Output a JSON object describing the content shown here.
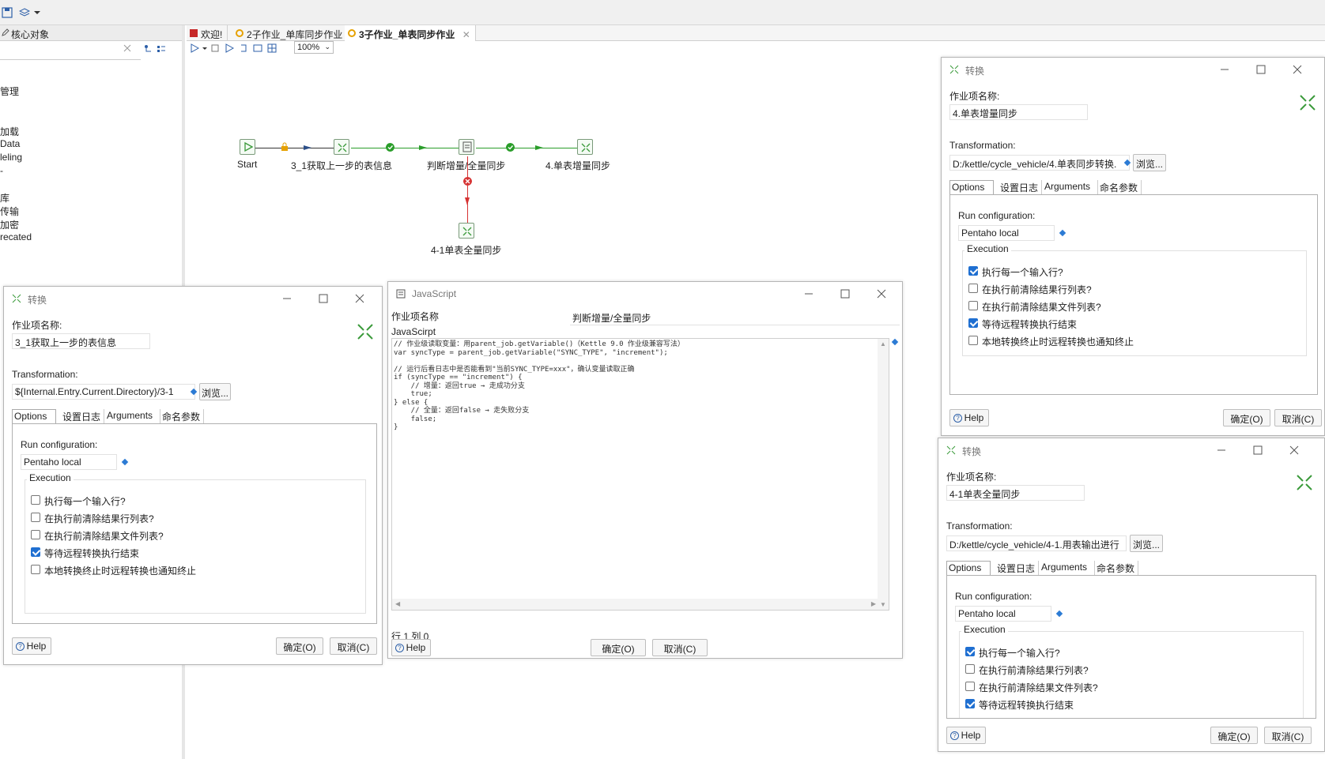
{
  "left_panel": {
    "tab_label": "核心对象",
    "tree_items": [
      "管理",
      "加载",
      "Data",
      "leling",
      "-",
      "库",
      "传输",
      "加密",
      "recated"
    ]
  },
  "editor_tabs": [
    {
      "label": "欢迎!"
    },
    {
      "label": "2子作业_单库同步作业"
    },
    {
      "label": "3子作业_单表同步作业"
    }
  ],
  "zoom": "100%",
  "job": {
    "nodes": {
      "start": "Start",
      "get_table_info": "3_1获取上一步的表信息",
      "judge": "判断增量/全量同步",
      "incremental": "4.单表增量同步",
      "full": "4-1单表全量同步"
    }
  },
  "dialog_left": {
    "title": "转换",
    "name_label": "作业项名称:",
    "name_value": "3_1获取上一步的表信息",
    "transformation_label": "Transformation:",
    "transformation_value": "${Internal.Entry.Current.Directory}/3-1",
    "browse": "浏览...",
    "tabs": [
      "Options",
      "设置日志",
      "Arguments",
      "命名参数"
    ],
    "run_config_label": "Run configuration:",
    "run_config_value": "Pentaho local",
    "execution_label": "Execution",
    "options": [
      {
        "label": "执行每一个输入行?",
        "checked": false
      },
      {
        "label": "在执行前清除结果行列表?",
        "checked": false
      },
      {
        "label": "在执行前清除结果文件列表?",
        "checked": false
      },
      {
        "label": "等待远程转换执行结束",
        "checked": true
      },
      {
        "label": "本地转换终止时远程转换也通知终止",
        "checked": false
      }
    ],
    "help": "Help",
    "ok": "确定(O)",
    "cancel": "取消(C)"
  },
  "dialog_js": {
    "title": "JavaScript",
    "name_label": "作业项名称",
    "name_value": "判断增量/全量同步",
    "script_label": "JavaScirpt",
    "code": "// 作业级读取变量：用parent_job.getVariable()（Kettle 9.0 作业级兼容写法）\nvar syncType = parent_job.getVariable(\"SYNC_TYPE\", \"increment\");\n\n// 运行后看日志中是否能看到\"当前SYNC_TYPE=xxx\"，确认变量读取正确\nif (syncType == \"increment\") {\n    // 增量：返回true → 走成功分支\n    true;\n} else {\n    // 全量：返回false → 走失败分支\n    false;\n}",
    "position": "行 1 列 0",
    "help": "Help",
    "ok": "确定(O)",
    "cancel": "取消(C)"
  },
  "dialog_right_top": {
    "title": "转换",
    "name_label": "作业项名称:",
    "name_value": "4.单表增量同步",
    "transformation_label": "Transformation:",
    "transformation_value": "D:/kettle/cycle_vehicle/4.单表同步转换.",
    "browse": "浏览...",
    "tabs": [
      "Options",
      "设置日志",
      "Arguments",
      "命名参数"
    ],
    "run_config_label": "Run configuration:",
    "run_config_value": "Pentaho local",
    "execution_label": "Execution",
    "options": [
      {
        "label": "执行每一个输入行?",
        "checked": true
      },
      {
        "label": "在执行前清除结果行列表?",
        "checked": false
      },
      {
        "label": "在执行前清除结果文件列表?",
        "checked": false
      },
      {
        "label": "等待远程转换执行结束",
        "checked": true
      },
      {
        "label": "本地转换终止时远程转换也通知终止",
        "checked": false
      }
    ],
    "help": "Help",
    "ok": "确定(O)",
    "cancel": "取消(C)"
  },
  "dialog_right_bottom": {
    "title": "转换",
    "name_label": "作业项名称:",
    "name_value": "4-1单表全量同步",
    "transformation_label": "Transformation:",
    "transformation_value": "D:/kettle/cycle_vehicle/4-1.用表输出进行",
    "browse": "浏览...",
    "tabs": [
      "Options",
      "设置日志",
      "Arguments",
      "命名参数"
    ],
    "run_config_label": "Run configuration:",
    "run_config_value": "Pentaho local",
    "execution_label": "Execution",
    "options": [
      {
        "label": "执行每一个输入行?",
        "checked": true
      },
      {
        "label": "在执行前清除结果行列表?",
        "checked": false
      },
      {
        "label": "在执行前清除结果文件列表?",
        "checked": false
      },
      {
        "label": "等待远程转换执行结束",
        "checked": true
      }
    ],
    "help": "Help",
    "ok": "确定(O)",
    "cancel": "取消(C)"
  },
  "colors": {
    "accent": "#1f6fd1",
    "hop_ok": "#2a9d2a",
    "hop_fail": "#d63333",
    "node_green": "#3a9a3a"
  }
}
